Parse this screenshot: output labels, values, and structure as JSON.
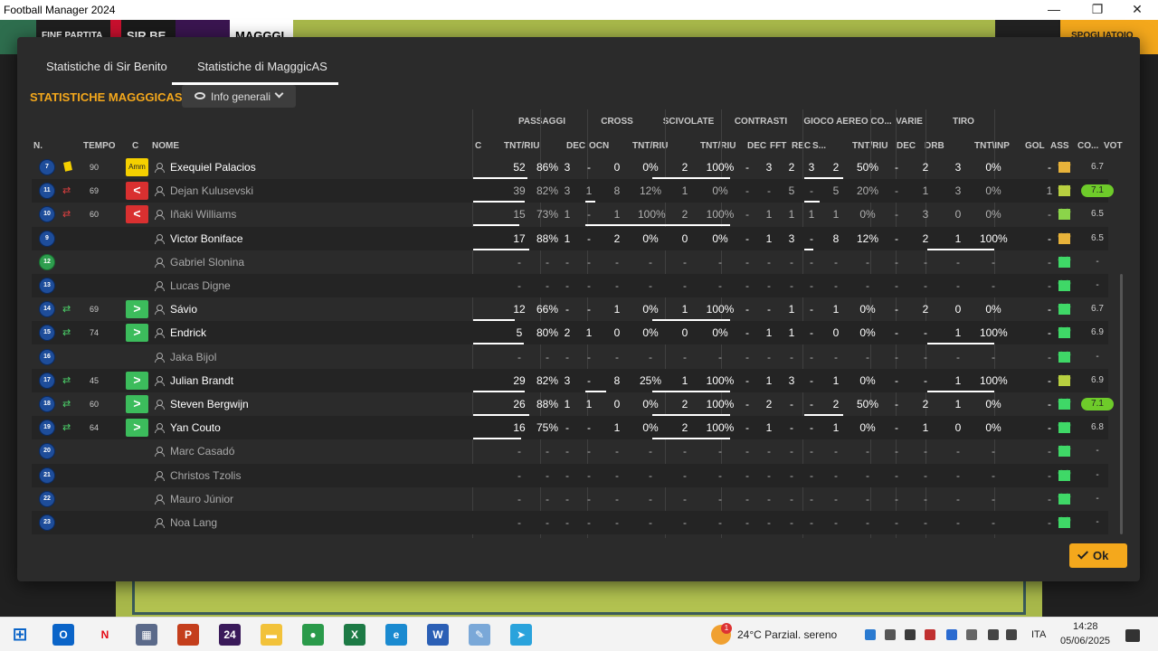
{
  "window": {
    "title": "Football Manager 2024",
    "min": "—",
    "max": "❐",
    "close": "✕"
  },
  "topbar": {
    "full_time": "FINE PARTITA",
    "home": "SIR BE",
    "away": "MAGGGI",
    "action": "SPOGLIATOIO"
  },
  "tabs": [
    "Statistiche di Sir Benito",
    "Statistiche di MagggicAS"
  ],
  "section_title": "STATISTICHE MAGGGICAS",
  "view_dropdown": "Info generali",
  "group_headers": [
    {
      "label": "PASSAGGI"
    },
    {
      "label": "CROSS"
    },
    {
      "label": "SCIVOLATE"
    },
    {
      "label": "CONTRASTI"
    },
    {
      "label": "GIOCO AEREO"
    },
    {
      "label": "CO..."
    },
    {
      "label": "VARIE"
    },
    {
      "label": "TIRO"
    }
  ],
  "columns": [
    "N.",
    "TEMPO",
    "C",
    "NOME",
    "C",
    "TNT/RIU",
    "DEC",
    "OCN",
    "TNT/RIU",
    "TNT/RIU",
    "DEC",
    "FFT",
    "REC",
    "S...",
    "TNT/RIU",
    "DEC",
    "DRB",
    "TNT\\INP",
    "GOL",
    "ASS",
    "CO...",
    "VOT"
  ],
  "players": [
    {
      "n": "7",
      "tempo": "90",
      "ev": "yellow",
      "c": "amm",
      "c_label": "Amm",
      "name": "Exequiel Palacios",
      "dim": false,
      "pass_t": "52",
      "pass_p": "86%",
      "pass_bar": 0.86,
      "dec": "3",
      "ocn": "-",
      "cr_t": "0",
      "cr_p": "0%",
      "cr_bar": 0,
      "sc_t": "2",
      "sc_p": "100%",
      "sc_bar": 1,
      "c_dec": "-",
      "fft": "3",
      "rec": "2",
      "s": "3",
      "ga_t": "2",
      "ga_p": "50%",
      "ga_bar": 0.5,
      "co": "-",
      "drb": "2",
      "ti_t": "3",
      "ti_p": "0%",
      "ti_bar": 0,
      "gol": "",
      "ass": "-",
      "heart": "#e8b33a",
      "vot": "6.7",
      "hi": false
    },
    {
      "n": "11",
      "tempo": "69",
      "ev": "out",
      "c": "red",
      "c_label": "<",
      "name": "Dejan Kulusevski",
      "dim": true,
      "pass_t": "39",
      "pass_p": "82%",
      "pass_bar": 0.82,
      "dec": "3",
      "ocn": "1",
      "cr_t": "8",
      "cr_p": "12%",
      "cr_bar": 0.12,
      "sc_t": "1",
      "sc_p": "0%",
      "sc_bar": 0,
      "c_dec": "-",
      "fft": "-",
      "rec": "5",
      "s": "-",
      "ga_t": "5",
      "ga_p": "20%",
      "ga_bar": 0.2,
      "co": "-",
      "drb": "1",
      "ti_t": "3",
      "ti_p": "0%",
      "ti_bar": 0,
      "gol": "",
      "ass": "1",
      "heart": "#b8d040",
      "vot": "7.1",
      "hi": true
    },
    {
      "n": "10",
      "tempo": "60",
      "ev": "out",
      "c": "red",
      "c_label": "<",
      "name": "Iñaki Williams",
      "dim": true,
      "pass_t": "15",
      "pass_p": "73%",
      "pass_bar": 0.73,
      "dec": "1",
      "ocn": "-",
      "cr_t": "1",
      "cr_p": "100%",
      "cr_bar": 1,
      "sc_t": "2",
      "sc_p": "100%",
      "sc_bar": 1,
      "c_dec": "-",
      "fft": "1",
      "rec": "1",
      "s": "1",
      "ga_t": "1",
      "ga_p": "0%",
      "ga_bar": 0,
      "co": "-",
      "drb": "3",
      "ti_t": "0",
      "ti_p": "0%",
      "ti_bar": 0,
      "gol": "",
      "ass": "-",
      "heart": "#8bd44a",
      "vot": "6.5",
      "hi": false
    },
    {
      "n": "9",
      "tempo": "",
      "ev": "",
      "c": "",
      "c_label": "",
      "name": "Victor Boniface",
      "dim": false,
      "pass_t": "17",
      "pass_p": "88%",
      "pass_bar": 0.88,
      "dec": "1",
      "ocn": "-",
      "cr_t": "2",
      "cr_p": "0%",
      "cr_bar": 0,
      "sc_t": "0",
      "sc_p": "0%",
      "sc_bar": 0,
      "c_dec": "-",
      "fft": "1",
      "rec": "3",
      "s": "-",
      "ga_t": "8",
      "ga_p": "12%",
      "ga_bar": 0.12,
      "co": "-",
      "drb": "2",
      "ti_t": "1",
      "ti_p": "100%",
      "ti_bar": 1,
      "gol": "",
      "ass": "-",
      "heart": "#e8b33a",
      "vot": "6.5",
      "hi": false
    },
    {
      "n": "12",
      "tempo": "",
      "ev": "",
      "c": "",
      "c_label": "",
      "name": "Gabriel Slonina",
      "dim": true,
      "gk": true,
      "pass_t": "-",
      "pass_p": "-",
      "pass_bar": 0,
      "dec": "-",
      "ocn": "-",
      "cr_t": "-",
      "cr_p": "-",
      "cr_bar": 0,
      "sc_t": "-",
      "sc_p": "-",
      "sc_bar": 0,
      "c_dec": "-",
      "fft": "-",
      "rec": "-",
      "s": "-",
      "ga_t": "-",
      "ga_p": "-",
      "ga_bar": 0,
      "co": "-",
      "drb": "-",
      "ti_t": "-",
      "ti_p": "-",
      "ti_bar": 0,
      "gol": "",
      "ass": "-",
      "heart": "#3fd867",
      "vot": "-",
      "hi": false
    },
    {
      "n": "13",
      "tempo": "",
      "ev": "",
      "c": "",
      "c_label": "",
      "name": "Lucas Digne",
      "dim": true,
      "pass_t": "-",
      "pass_p": "-",
      "pass_bar": 0,
      "dec": "-",
      "ocn": "-",
      "cr_t": "-",
      "cr_p": "-",
      "cr_bar": 0,
      "sc_t": "-",
      "sc_p": "-",
      "sc_bar": 0,
      "c_dec": "-",
      "fft": "-",
      "rec": "-",
      "s": "-",
      "ga_t": "-",
      "ga_p": "-",
      "ga_bar": 0,
      "co": "-",
      "drb": "-",
      "ti_t": "-",
      "ti_p": "-",
      "ti_bar": 0,
      "gol": "",
      "ass": "-",
      "heart": "#3fd867",
      "vot": "-",
      "hi": false
    },
    {
      "n": "14",
      "tempo": "69",
      "ev": "in",
      "c": "green",
      "c_label": ">",
      "name": "Sávio",
      "dim": false,
      "pass_t": "12",
      "pass_p": "66%",
      "pass_bar": 0.66,
      "dec": "-",
      "ocn": "-",
      "cr_t": "1",
      "cr_p": "0%",
      "cr_bar": 0,
      "sc_t": "1",
      "sc_p": "100%",
      "sc_bar": 1,
      "c_dec": "-",
      "fft": "-",
      "rec": "1",
      "s": "-",
      "ga_t": "1",
      "ga_p": "0%",
      "ga_bar": 0,
      "co": "-",
      "drb": "2",
      "ti_t": "0",
      "ti_p": "0%",
      "ti_bar": 0,
      "gol": "",
      "ass": "-",
      "heart": "#3fd867",
      "vot": "6.7",
      "hi": false
    },
    {
      "n": "15",
      "tempo": "74",
      "ev": "in",
      "c": "green",
      "c_label": ">",
      "name": "Endrick",
      "dim": false,
      "pass_t": "5",
      "pass_p": "80%",
      "pass_bar": 0.8,
      "dec": "2",
      "ocn": "1",
      "cr_t": "0",
      "cr_p": "0%",
      "cr_bar": 0,
      "sc_t": "0",
      "sc_p": "0%",
      "sc_bar": 0,
      "c_dec": "-",
      "fft": "1",
      "rec": "1",
      "s": "-",
      "ga_t": "0",
      "ga_p": "0%",
      "ga_bar": 0,
      "co": "-",
      "drb": "-",
      "ti_t": "1",
      "ti_p": "100%",
      "ti_bar": 1,
      "gol": "",
      "ass": "-",
      "heart": "#3fd867",
      "vot": "6.9",
      "hi": false
    },
    {
      "n": "16",
      "tempo": "",
      "ev": "",
      "c": "",
      "c_label": "",
      "name": "Jaka Bijol",
      "dim": true,
      "pass_t": "-",
      "pass_p": "-",
      "pass_bar": 0,
      "dec": "-",
      "ocn": "-",
      "cr_t": "-",
      "cr_p": "-",
      "cr_bar": 0,
      "sc_t": "-",
      "sc_p": "-",
      "sc_bar": 0,
      "c_dec": "-",
      "fft": "-",
      "rec": "-",
      "s": "-",
      "ga_t": "-",
      "ga_p": "-",
      "ga_bar": 0,
      "co": "-",
      "drb": "-",
      "ti_t": "-",
      "ti_p": "-",
      "ti_bar": 0,
      "gol": "",
      "ass": "-",
      "heart": "#3fd867",
      "vot": "-",
      "hi": false
    },
    {
      "n": "17",
      "tempo": "45",
      "ev": "in",
      "c": "green",
      "c_label": ">",
      "name": "Julian Brandt",
      "dim": false,
      "pass_t": "29",
      "pass_p": "82%",
      "pass_bar": 0.82,
      "dec": "3",
      "ocn": "-",
      "cr_t": "8",
      "cr_p": "25%",
      "cr_bar": 0.25,
      "sc_t": "1",
      "sc_p": "100%",
      "sc_bar": 1,
      "c_dec": "-",
      "fft": "1",
      "rec": "3",
      "s": "-",
      "ga_t": "1",
      "ga_p": "0%",
      "ga_bar": 0,
      "co": "-",
      "drb": "-",
      "ti_t": "1",
      "ti_p": "100%",
      "ti_bar": 1,
      "gol": "",
      "ass": "-",
      "heart": "#b8d040",
      "vot": "6.9",
      "hi": false
    },
    {
      "n": "18",
      "tempo": "60",
      "ev": "in",
      "c": "green",
      "c_label": ">",
      "name": "Steven Bergwijn",
      "dim": false,
      "pass_t": "26",
      "pass_p": "88%",
      "pass_bar": 0.88,
      "dec": "1",
      "ocn": "1",
      "cr_t": "0",
      "cr_p": "0%",
      "cr_bar": 0,
      "sc_t": "2",
      "sc_p": "100%",
      "sc_bar": 1,
      "c_dec": "-",
      "fft": "2",
      "rec": "-",
      "s": "-",
      "ga_t": "2",
      "ga_p": "50%",
      "ga_bar": 0.5,
      "co": "-",
      "drb": "2",
      "ti_t": "1",
      "ti_p": "0%",
      "ti_bar": 0,
      "gol": "",
      "ass": "-",
      "heart": "#3fd867",
      "vot": "7.1",
      "hi": true
    },
    {
      "n": "19",
      "tempo": "64",
      "ev": "in",
      "c": "green",
      "c_label": ">",
      "name": "Yan Couto",
      "dim": false,
      "pass_t": "16",
      "pass_p": "75%",
      "pass_bar": 0.75,
      "dec": "-",
      "ocn": "-",
      "cr_t": "1",
      "cr_p": "0%",
      "cr_bar": 0,
      "sc_t": "2",
      "sc_p": "100%",
      "sc_bar": 1,
      "c_dec": "-",
      "fft": "1",
      "rec": "-",
      "s": "-",
      "ga_t": "1",
      "ga_p": "0%",
      "ga_bar": 0,
      "co": "-",
      "drb": "1",
      "ti_t": "0",
      "ti_p": "0%",
      "ti_bar": 0,
      "gol": "",
      "ass": "-",
      "heart": "#3fd867",
      "vot": "6.8",
      "hi": false
    },
    {
      "n": "20",
      "tempo": "",
      "ev": "",
      "c": "",
      "c_label": "",
      "name": "Marc Casadó",
      "dim": true,
      "pass_t": "-",
      "pass_p": "-",
      "pass_bar": 0,
      "dec": "-",
      "ocn": "-",
      "cr_t": "-",
      "cr_p": "-",
      "cr_bar": 0,
      "sc_t": "-",
      "sc_p": "-",
      "sc_bar": 0,
      "c_dec": "-",
      "fft": "-",
      "rec": "-",
      "s": "-",
      "ga_t": "-",
      "ga_p": "-",
      "ga_bar": 0,
      "co": "-",
      "drb": "-",
      "ti_t": "-",
      "ti_p": "-",
      "ti_bar": 0,
      "gol": "",
      "ass": "-",
      "heart": "#3fd867",
      "vot": "-",
      "hi": false
    },
    {
      "n": "21",
      "tempo": "",
      "ev": "",
      "c": "",
      "c_label": "",
      "name": "Christos Tzolis",
      "dim": true,
      "pass_t": "-",
      "pass_p": "-",
      "pass_bar": 0,
      "dec": "-",
      "ocn": "-",
      "cr_t": "-",
      "cr_p": "-",
      "cr_bar": 0,
      "sc_t": "-",
      "sc_p": "-",
      "sc_bar": 0,
      "c_dec": "-",
      "fft": "-",
      "rec": "-",
      "s": "-",
      "ga_t": "-",
      "ga_p": "-",
      "ga_bar": 0,
      "co": "-",
      "drb": "-",
      "ti_t": "-",
      "ti_p": "-",
      "ti_bar": 0,
      "gol": "",
      "ass": "-",
      "heart": "#3fd867",
      "vot": "-",
      "hi": false
    },
    {
      "n": "22",
      "tempo": "",
      "ev": "",
      "c": "",
      "c_label": "",
      "name": "Mauro Júnior",
      "dim": true,
      "pass_t": "-",
      "pass_p": "-",
      "pass_bar": 0,
      "dec": "-",
      "ocn": "-",
      "cr_t": "-",
      "cr_p": "-",
      "cr_bar": 0,
      "sc_t": "-",
      "sc_p": "-",
      "sc_bar": 0,
      "c_dec": "-",
      "fft": "-",
      "rec": "-",
      "s": "-",
      "ga_t": "-",
      "ga_p": "-",
      "ga_bar": 0,
      "co": "-",
      "drb": "-",
      "ti_t": "-",
      "ti_p": "-",
      "ti_bar": 0,
      "gol": "",
      "ass": "-",
      "heart": "#3fd867",
      "vot": "-",
      "hi": false
    },
    {
      "n": "23",
      "tempo": "",
      "ev": "",
      "c": "",
      "c_label": "",
      "name": "Noa Lang",
      "dim": true,
      "pass_t": "-",
      "pass_p": "-",
      "pass_bar": 0,
      "dec": "-",
      "ocn": "-",
      "cr_t": "-",
      "cr_p": "-",
      "cr_bar": 0,
      "sc_t": "-",
      "sc_p": "-",
      "sc_bar": 0,
      "c_dec": "-",
      "fft": "-",
      "rec": "-",
      "s": "-",
      "ga_t": "-",
      "ga_p": "-",
      "ga_bar": 0,
      "co": "-",
      "drb": "-",
      "ti_t": "-",
      "ti_p": "-",
      "ti_bar": 0,
      "gol": "",
      "ass": "-",
      "heart": "#3fd867",
      "vot": "-",
      "hi": false
    }
  ],
  "ok_label": "Ok",
  "taskbar": {
    "weather_badge": "1",
    "weather": "24°C  Parzial. sereno",
    "lang": "ITA",
    "time": "14:28",
    "date": "05/06/2025",
    "apps": [
      {
        "name": "outlook-icon",
        "label": "O",
        "color": "#0a64c8"
      },
      {
        "name": "netflix-icon",
        "label": "N",
        "color": "#f3f3f3",
        "fg": "#e50914"
      },
      {
        "name": "calculator-icon",
        "label": "▦",
        "color": "#5b6a8a"
      },
      {
        "name": "powerpoint-icon",
        "label": "P",
        "color": "#c43e1c"
      },
      {
        "name": "football-manager-icon",
        "label": "24",
        "color": "#3a1a5a"
      },
      {
        "name": "file-explorer-icon",
        "label": "▬",
        "color": "#f2c23a"
      },
      {
        "name": "chrome-icon",
        "label": "●",
        "color": "#2a9a4a"
      },
      {
        "name": "excel-icon",
        "label": "X",
        "color": "#1d7a45"
      },
      {
        "name": "edge-icon",
        "label": "e",
        "color": "#1a8ad0"
      },
      {
        "name": "word-icon",
        "label": "W",
        "color": "#2b5fb5"
      },
      {
        "name": "paint-icon",
        "label": "✎",
        "color": "#7aa8d8"
      },
      {
        "name": "telegram-icon",
        "label": "➤",
        "color": "#2aa3dc"
      }
    ]
  }
}
